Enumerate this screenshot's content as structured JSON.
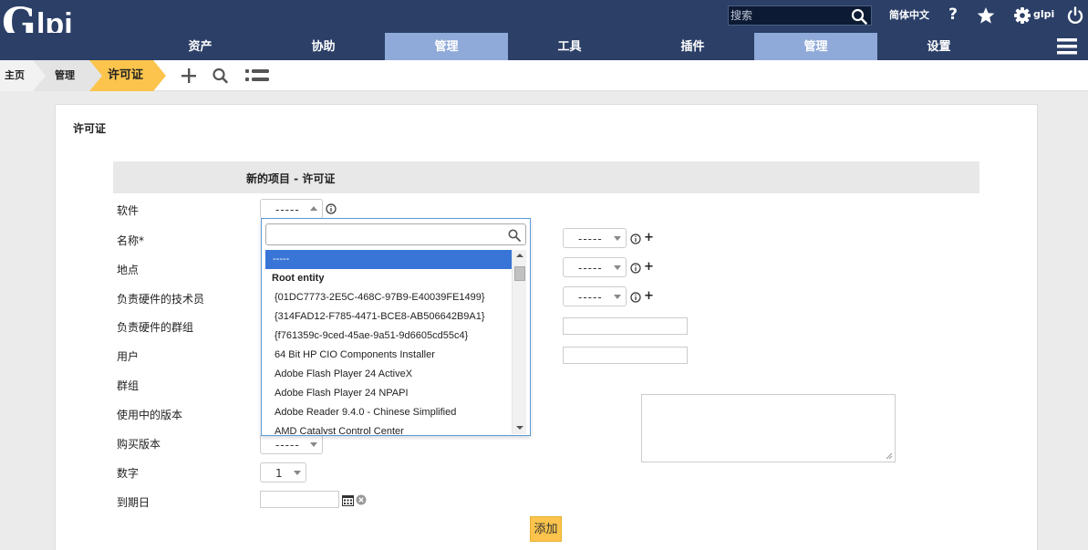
{
  "header": {
    "logo": "Glpi",
    "search_placeholder": "搜索",
    "language": "简体中文",
    "user": "glpi"
  },
  "nav": {
    "items": [
      {
        "label": "资产",
        "active": false
      },
      {
        "label": "协助",
        "active": false
      },
      {
        "label": "管理",
        "active": true
      },
      {
        "label": "工具",
        "active": false
      },
      {
        "label": "插件",
        "active": false
      },
      {
        "label": "管理",
        "active": true
      },
      {
        "label": "设置",
        "active": false
      }
    ]
  },
  "breadcrumb": {
    "home": "主页",
    "admin": "管理",
    "current": "许可证"
  },
  "page": {
    "title": "许可证",
    "form_title": "新的项目 - 许可证"
  },
  "form": {
    "software_label": "软件",
    "software_value": "-----",
    "name_label": "名称*",
    "location_label": "地点",
    "tech_label": "负责硬件的技术员",
    "tech_group_label": "负责硬件的群组",
    "user_label": "用户",
    "group_label": "群组",
    "version_in_use_label": "使用中的版本",
    "purchase_version_label": "购买版本",
    "purchase_version_value": "-----",
    "number_label": "数字",
    "number_value": "1",
    "expiration_label": "到期日",
    "right_select_1": "-----",
    "right_select_2": "-----",
    "right_select_3": "-----",
    "plus": "+",
    "add_button": "添加"
  },
  "dropdown": {
    "items": [
      {
        "label": "-----",
        "type": "selected"
      },
      {
        "label": "Root entity",
        "type": "group"
      },
      {
        "label": "{01DC7773-2E5C-468C-97B9-E40039FE1499}",
        "type": "option"
      },
      {
        "label": "{314FAD12-F785-4471-BCE8-AB506642B9A1}",
        "type": "option"
      },
      {
        "label": "{f761359c-9ced-45ae-9a51-9d6605cd55c4}",
        "type": "option"
      },
      {
        "label": "64 Bit HP CIO Components Installer",
        "type": "option"
      },
      {
        "label": "Adobe Flash Player 24 ActiveX",
        "type": "option"
      },
      {
        "label": "Adobe Flash Player 24 NPAPI",
        "type": "option"
      },
      {
        "label": "Adobe Reader 9.4.0 - Chinese Simplified",
        "type": "option"
      },
      {
        "label": "AMD Catalyst Control Center",
        "type": "option"
      }
    ]
  }
}
